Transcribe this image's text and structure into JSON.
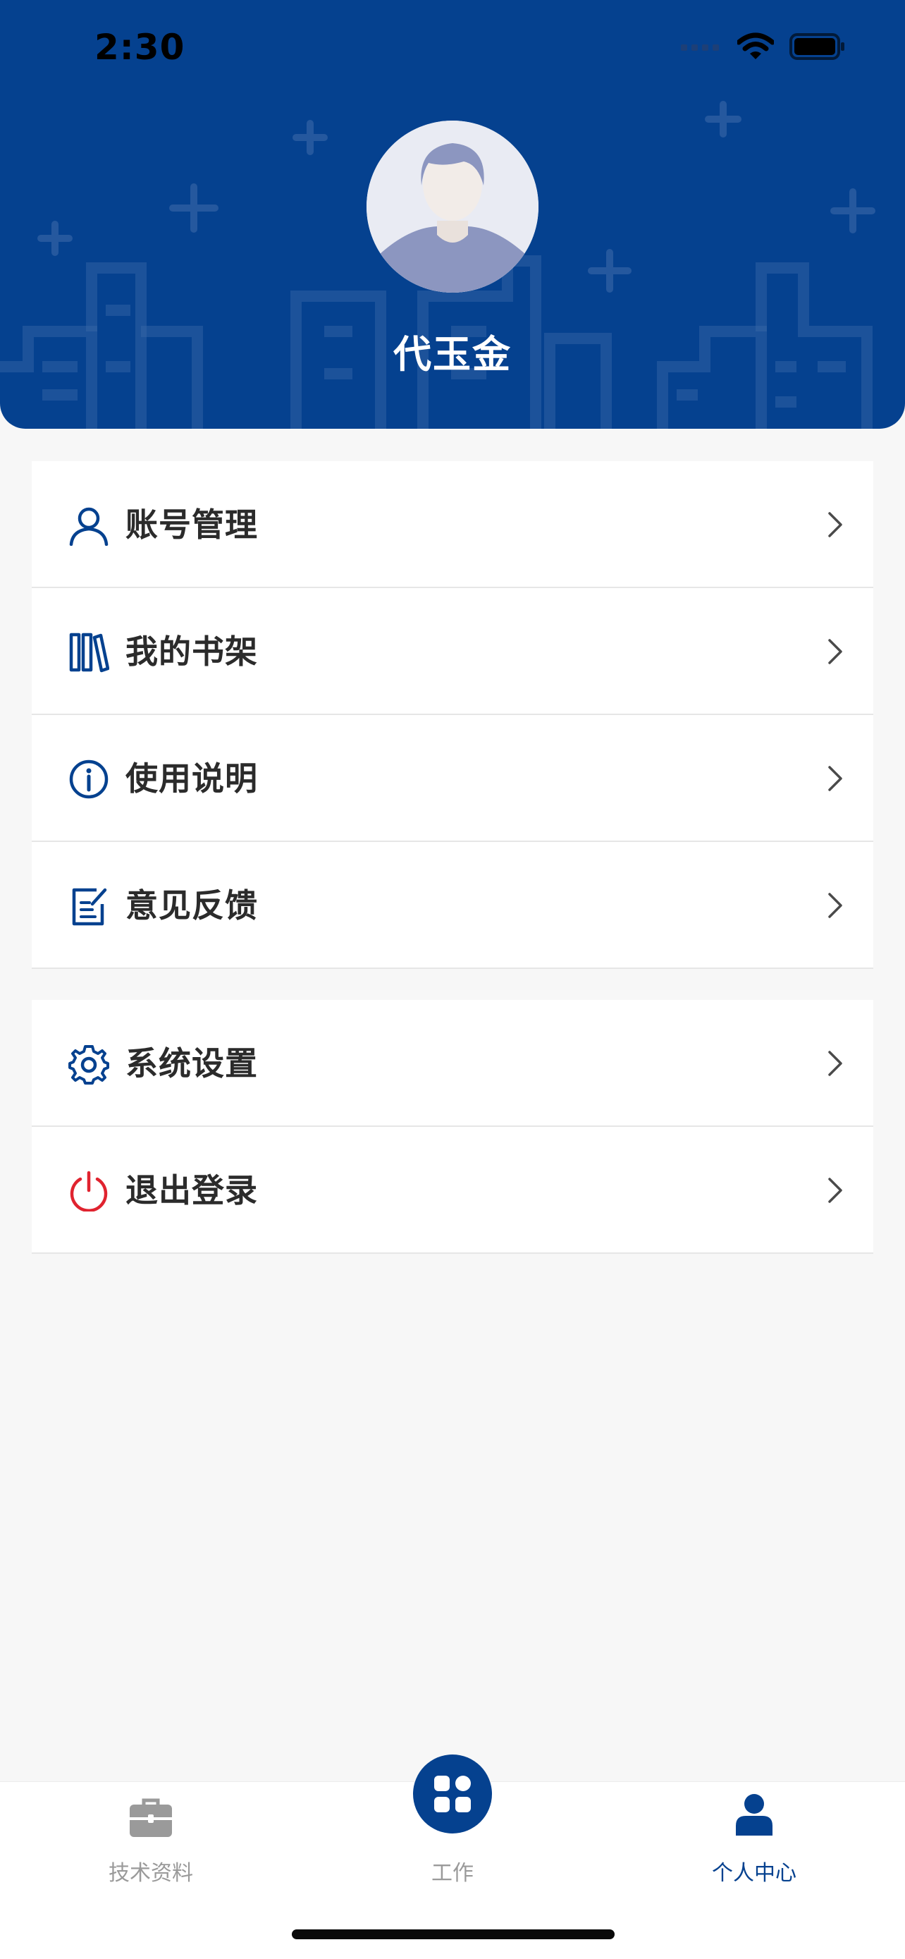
{
  "status_bar": {
    "time": "2:30"
  },
  "profile": {
    "name": "代玉金"
  },
  "menu": {
    "group1": [
      {
        "label": "账号管理",
        "icon": "user-icon"
      },
      {
        "label": "我的书架",
        "icon": "bookshelf-icon"
      },
      {
        "label": "使用说明",
        "icon": "info-icon"
      },
      {
        "label": "意见反馈",
        "icon": "feedback-edit-icon"
      }
    ],
    "group2": [
      {
        "label": "系统设置",
        "icon": "gear-icon"
      },
      {
        "label": "退出登录",
        "icon": "power-icon"
      }
    ]
  },
  "tabbar": {
    "items": [
      {
        "label": "技术资料",
        "icon": "briefcase-icon",
        "active": false
      },
      {
        "label": "工作",
        "icon": "grid-apps-icon",
        "active": false
      },
      {
        "label": "个人中心",
        "icon": "person-icon",
        "active": true
      }
    ]
  },
  "colors": {
    "brand": "#05418f",
    "logout": "#e0232f",
    "inactive_tab": "#9a9a9a"
  }
}
